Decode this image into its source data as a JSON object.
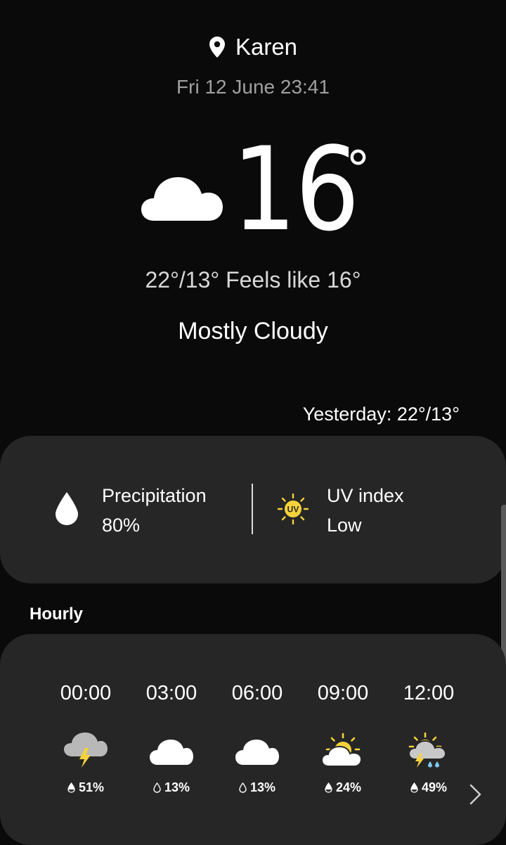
{
  "location": {
    "name": "Karen",
    "icon": "location-pin-icon"
  },
  "datetime": "Fri 12 June 23:41",
  "current": {
    "icon": "cloud-icon",
    "temperature": "16",
    "degree_symbol": "°",
    "hi_lo_feels": "22°/13° Feels like 16°",
    "condition": "Mostly Cloudy"
  },
  "yesterday": "Yesterday: 22°/13°",
  "details": {
    "precipitation": {
      "label": "Precipitation",
      "value": "80%",
      "icon": "raindrop-icon"
    },
    "uv": {
      "label": "UV index",
      "value": "Low",
      "icon": "uv-sun-icon",
      "badge": "UV"
    }
  },
  "hourly": {
    "title": "Hourly",
    "items": [
      {
        "time": "00:00",
        "icon": "thunder-cloud-icon",
        "precip": "51%"
      },
      {
        "time": "03:00",
        "icon": "cloud-icon",
        "precip": "13%"
      },
      {
        "time": "06:00",
        "icon": "cloud-icon",
        "precip": "13%"
      },
      {
        "time": "09:00",
        "icon": "partly-sunny-icon",
        "precip": "24%"
      },
      {
        "time": "12:00",
        "icon": "sun-thunder-rain-icon",
        "precip": "49%"
      }
    ],
    "next_icon": "chevron-right-icon"
  },
  "colors": {
    "background": "#0a0a0a",
    "card": "#262626",
    "sun_yellow": "#f6d33a",
    "secondary_text": "#a0a0a0"
  }
}
